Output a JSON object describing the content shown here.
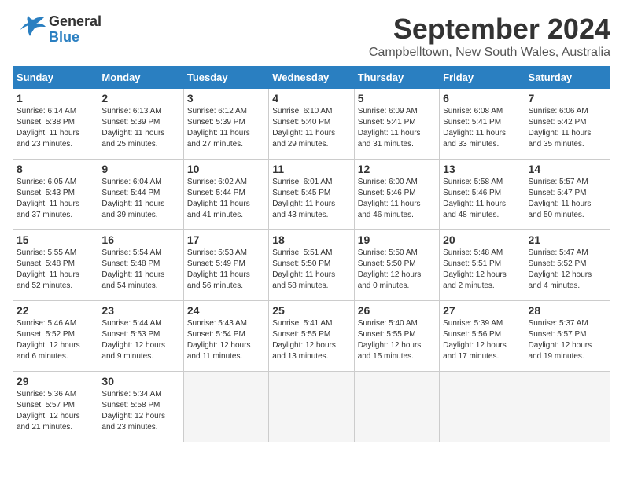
{
  "header": {
    "logo_general": "General",
    "logo_blue": "Blue",
    "month_title": "September 2024",
    "location": "Campbelltown, New South Wales, Australia"
  },
  "days_of_week": [
    "Sunday",
    "Monday",
    "Tuesday",
    "Wednesday",
    "Thursday",
    "Friday",
    "Saturday"
  ],
  "cells": [
    {
      "day": "",
      "info": ""
    },
    {
      "day": "1",
      "info": "Sunrise: 6:14 AM\nSunset: 5:38 PM\nDaylight: 11 hours\nand 23 minutes."
    },
    {
      "day": "2",
      "info": "Sunrise: 6:13 AM\nSunset: 5:39 PM\nDaylight: 11 hours\nand 25 minutes."
    },
    {
      "day": "3",
      "info": "Sunrise: 6:12 AM\nSunset: 5:39 PM\nDaylight: 11 hours\nand 27 minutes."
    },
    {
      "day": "4",
      "info": "Sunrise: 6:10 AM\nSunset: 5:40 PM\nDaylight: 11 hours\nand 29 minutes."
    },
    {
      "day": "5",
      "info": "Sunrise: 6:09 AM\nSunset: 5:41 PM\nDaylight: 11 hours\nand 31 minutes."
    },
    {
      "day": "6",
      "info": "Sunrise: 6:08 AM\nSunset: 5:41 PM\nDaylight: 11 hours\nand 33 minutes."
    },
    {
      "day": "7",
      "info": "Sunrise: 6:06 AM\nSunset: 5:42 PM\nDaylight: 11 hours\nand 35 minutes."
    },
    {
      "day": "8",
      "info": "Sunrise: 6:05 AM\nSunset: 5:43 PM\nDaylight: 11 hours\nand 37 minutes."
    },
    {
      "day": "9",
      "info": "Sunrise: 6:04 AM\nSunset: 5:44 PM\nDaylight: 11 hours\nand 39 minutes."
    },
    {
      "day": "10",
      "info": "Sunrise: 6:02 AM\nSunset: 5:44 PM\nDaylight: 11 hours\nand 41 minutes."
    },
    {
      "day": "11",
      "info": "Sunrise: 6:01 AM\nSunset: 5:45 PM\nDaylight: 11 hours\nand 43 minutes."
    },
    {
      "day": "12",
      "info": "Sunrise: 6:00 AM\nSunset: 5:46 PM\nDaylight: 11 hours\nand 46 minutes."
    },
    {
      "day": "13",
      "info": "Sunrise: 5:58 AM\nSunset: 5:46 PM\nDaylight: 11 hours\nand 48 minutes."
    },
    {
      "day": "14",
      "info": "Sunrise: 5:57 AM\nSunset: 5:47 PM\nDaylight: 11 hours\nand 50 minutes."
    },
    {
      "day": "15",
      "info": "Sunrise: 5:55 AM\nSunset: 5:48 PM\nDaylight: 11 hours\nand 52 minutes."
    },
    {
      "day": "16",
      "info": "Sunrise: 5:54 AM\nSunset: 5:48 PM\nDaylight: 11 hours\nand 54 minutes."
    },
    {
      "day": "17",
      "info": "Sunrise: 5:53 AM\nSunset: 5:49 PM\nDaylight: 11 hours\nand 56 minutes."
    },
    {
      "day": "18",
      "info": "Sunrise: 5:51 AM\nSunset: 5:50 PM\nDaylight: 11 hours\nand 58 minutes."
    },
    {
      "day": "19",
      "info": "Sunrise: 5:50 AM\nSunset: 5:50 PM\nDaylight: 12 hours\nand 0 minutes."
    },
    {
      "day": "20",
      "info": "Sunrise: 5:48 AM\nSunset: 5:51 PM\nDaylight: 12 hours\nand 2 minutes."
    },
    {
      "day": "21",
      "info": "Sunrise: 5:47 AM\nSunset: 5:52 PM\nDaylight: 12 hours\nand 4 minutes."
    },
    {
      "day": "22",
      "info": "Sunrise: 5:46 AM\nSunset: 5:52 PM\nDaylight: 12 hours\nand 6 minutes."
    },
    {
      "day": "23",
      "info": "Sunrise: 5:44 AM\nSunset: 5:53 PM\nDaylight: 12 hours\nand 9 minutes."
    },
    {
      "day": "24",
      "info": "Sunrise: 5:43 AM\nSunset: 5:54 PM\nDaylight: 12 hours\nand 11 minutes."
    },
    {
      "day": "25",
      "info": "Sunrise: 5:41 AM\nSunset: 5:55 PM\nDaylight: 12 hours\nand 13 minutes."
    },
    {
      "day": "26",
      "info": "Sunrise: 5:40 AM\nSunset: 5:55 PM\nDaylight: 12 hours\nand 15 minutes."
    },
    {
      "day": "27",
      "info": "Sunrise: 5:39 AM\nSunset: 5:56 PM\nDaylight: 12 hours\nand 17 minutes."
    },
    {
      "day": "28",
      "info": "Sunrise: 5:37 AM\nSunset: 5:57 PM\nDaylight: 12 hours\nand 19 minutes."
    },
    {
      "day": "29",
      "info": "Sunrise: 5:36 AM\nSunset: 5:57 PM\nDaylight: 12 hours\nand 21 minutes."
    },
    {
      "day": "30",
      "info": "Sunrise: 5:34 AM\nSunset: 5:58 PM\nDaylight: 12 hours\nand 23 minutes."
    },
    {
      "day": "",
      "info": ""
    },
    {
      "day": "",
      "info": ""
    },
    {
      "day": "",
      "info": ""
    },
    {
      "day": "",
      "info": ""
    }
  ]
}
